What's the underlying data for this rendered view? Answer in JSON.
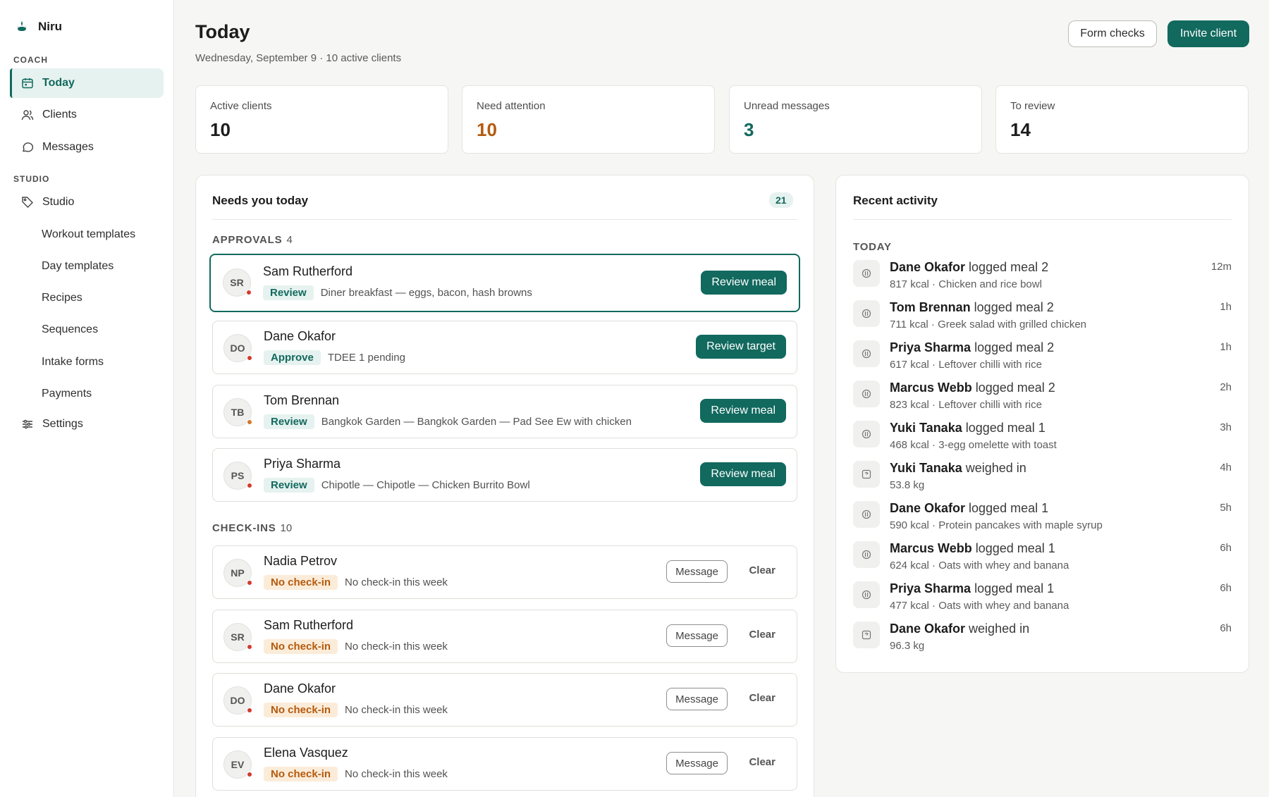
{
  "app": {
    "name": "Niru",
    "accent": "#12695e",
    "warning": "#b45a0e",
    "danger": "#d33a2c"
  },
  "sidebar": {
    "coach_label": "COACH",
    "studio_label": "STUDIO",
    "items": [
      {
        "label": "Today",
        "icon": "calendar-icon"
      },
      {
        "label": "Clients",
        "icon": "users-icon"
      },
      {
        "label": "Messages",
        "icon": "chat-icon"
      },
      {
        "label": "Studio",
        "icon": "tag-icon"
      },
      {
        "label": "Settings",
        "icon": "sliders-icon"
      }
    ],
    "studio_sub": [
      "Workout templates",
      "Day templates",
      "Recipes",
      "Sequences",
      "Intake forms",
      "Payments"
    ]
  },
  "header": {
    "title": "Today",
    "subtitle": "Wednesday, September 9 · 10 active clients",
    "form_checks": "Form checks",
    "invite_client": "Invite client"
  },
  "stats": [
    {
      "label": "Active clients",
      "value": "10",
      "color": "#1c1c1c"
    },
    {
      "label": "Need attention",
      "value": "10",
      "color": "#b45a0e"
    },
    {
      "label": "Unread messages",
      "value": "3",
      "color": "#12695e"
    },
    {
      "label": "To review",
      "value": "14",
      "color": "#1c1c1c"
    }
  ],
  "needs": {
    "title": "Needs you today",
    "count": "21",
    "approvals_label": "APPROVALS",
    "approvals_count": "4",
    "approvals": [
      {
        "initials": "SR",
        "name": "Sam Rutherford",
        "tag": "Review",
        "detail": "Diner breakfast — eggs, bacon, hash browns",
        "action": "Review meal",
        "dot": "#d33a2c"
      },
      {
        "initials": "DO",
        "name": "Dane Okafor",
        "tag": "Approve",
        "detail": "TDEE 1 pending",
        "action": "Review target",
        "dot": "#d33a2c"
      },
      {
        "initials": "TB",
        "name": "Tom Brennan",
        "tag": "Review",
        "detail": "Bangkok Garden — Bangkok Garden — Pad See Ew with chicken",
        "action": "Review meal",
        "dot": "#d4762a"
      },
      {
        "initials": "PS",
        "name": "Priya Sharma",
        "tag": "Review",
        "detail": "Chipotle — Chipotle — Chicken Burrito Bowl",
        "action": "Review meal",
        "dot": "#d33a2c"
      }
    ],
    "checkins_label": "CHECK-INS",
    "checkins_count": "10",
    "checkins": [
      {
        "initials": "NP",
        "name": "Nadia Petrov",
        "tag": "No check-in",
        "detail": "No check-in this week",
        "message": "Message",
        "clear": "Clear"
      },
      {
        "initials": "SR",
        "name": "Sam Rutherford",
        "tag": "No check-in",
        "detail": "No check-in this week",
        "message": "Message",
        "clear": "Clear"
      },
      {
        "initials": "DO",
        "name": "Dane Okafor",
        "tag": "No check-in",
        "detail": "No check-in this week",
        "message": "Message",
        "clear": "Clear"
      },
      {
        "initials": "EV",
        "name": "Elena Vasquez",
        "tag": "No check-in",
        "detail": "No check-in this week",
        "message": "Message",
        "clear": "Clear"
      }
    ]
  },
  "activity": {
    "title": "Recent activity",
    "day_label": "TODAY",
    "items": [
      {
        "who": "Dane Okafor",
        "what": " logged meal 2",
        "sub": "817 kcal · Chicken and rice bowl",
        "time": "12m",
        "icon": "meal-icon"
      },
      {
        "who": "Tom Brennan",
        "what": " logged meal 2",
        "sub": "711 kcal · Greek salad with grilled chicken",
        "time": "1h",
        "icon": "meal-icon"
      },
      {
        "who": "Priya Sharma",
        "what": " logged meal 2",
        "sub": "617 kcal · Leftover chilli with rice",
        "time": "1h",
        "icon": "meal-icon"
      },
      {
        "who": "Marcus Webb",
        "what": " logged meal 2",
        "sub": "823 kcal · Leftover chilli with rice",
        "time": "2h",
        "icon": "meal-icon"
      },
      {
        "who": "Yuki Tanaka",
        "what": " logged meal 1",
        "sub": "468 kcal · 3-egg omelette with toast",
        "time": "3h",
        "icon": "meal-icon"
      },
      {
        "who": "Yuki Tanaka",
        "what": " weighed in",
        "sub": "53.8 kg",
        "time": "4h",
        "icon": "scale-icon"
      },
      {
        "who": "Dane Okafor",
        "what": " logged meal 1",
        "sub": "590 kcal · Protein pancakes with maple syrup",
        "time": "5h",
        "icon": "meal-icon"
      },
      {
        "who": "Marcus Webb",
        "what": " logged meal 1",
        "sub": "624 kcal · Oats with whey and banana",
        "time": "6h",
        "icon": "meal-icon"
      },
      {
        "who": "Priya Sharma",
        "what": " logged meal 1",
        "sub": "477 kcal · Oats with whey and banana",
        "time": "6h",
        "icon": "meal-icon"
      },
      {
        "who": "Dane Okafor",
        "what": " weighed in",
        "sub": "96.3 kg",
        "time": "6h",
        "icon": "scale-icon"
      }
    ]
  }
}
